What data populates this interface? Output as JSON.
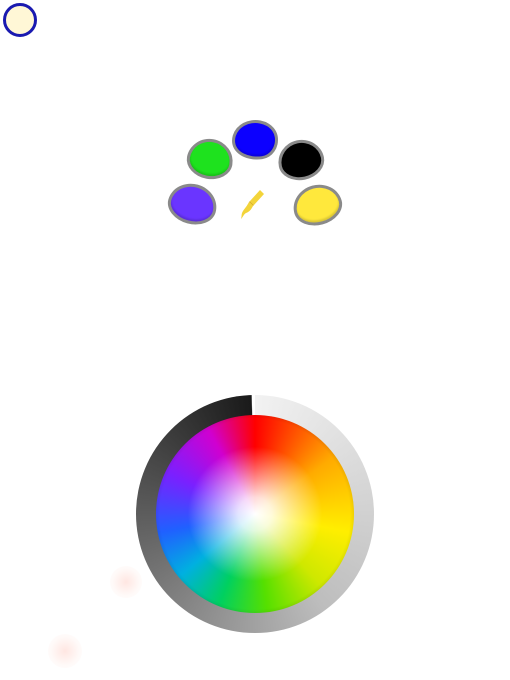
{
  "current_color": {
    "fill": "#fff7d6",
    "border": "#1a1ab0"
  },
  "palette": {
    "blobs": [
      {
        "id": "blue",
        "color": "#0c00ff"
      },
      {
        "id": "green",
        "color": "#1ee21e"
      },
      {
        "id": "black",
        "color": "#000000"
      },
      {
        "id": "purple",
        "color": "#6a35ff"
      },
      {
        "id": "yellow",
        "color": "#ffe83c"
      }
    ],
    "brush_icon": "paintbrush-icon",
    "brush_color": "#f3d43a"
  },
  "color_wheel": {
    "icon": "color-wheel",
    "ring": "brightness-ring"
  }
}
